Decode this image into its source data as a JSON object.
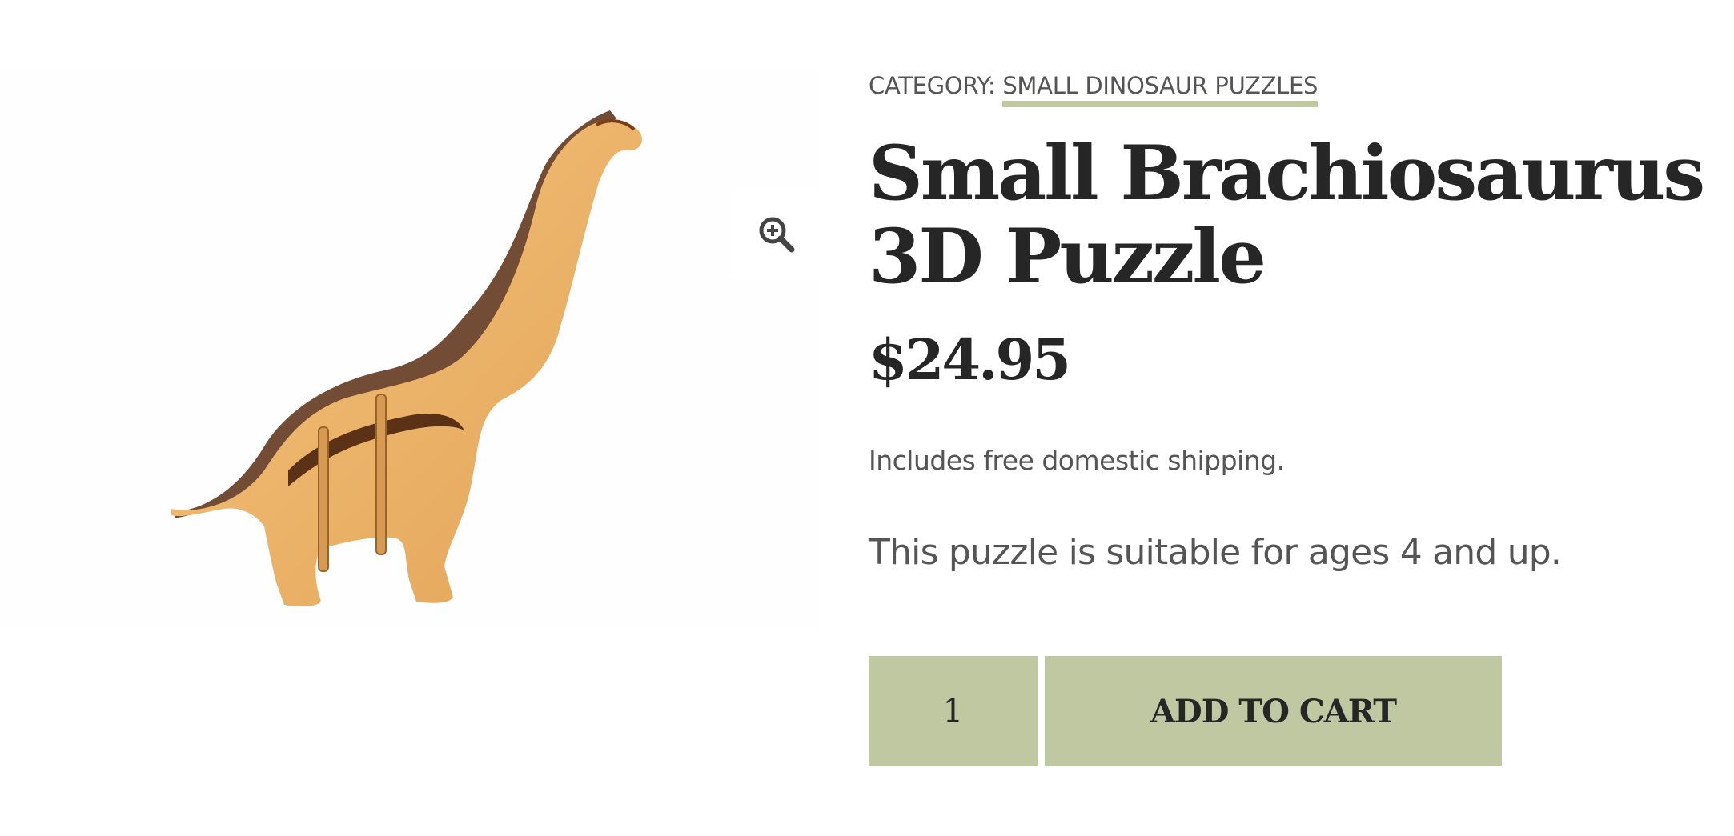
{
  "product": {
    "category_label": "CATEGORY:",
    "category_name": "SMALL DINOSAUR PUZZLES",
    "title": "Small Brachiosaurus 3D Puzzle",
    "price": "$24.95",
    "shipping_note": "Includes free domestic shipping.",
    "age_note": "This puzzle is suitable for ages 4 and up.",
    "image_icon": "brachiosaurus-puzzle-image"
  },
  "cart": {
    "quantity": "1",
    "add_to_cart_label": "ADD TO CART"
  },
  "icons": {
    "zoom": "zoom-in-icon"
  },
  "colors": {
    "accent": "#bfc8a1",
    "text_dark": "#262626",
    "text_muted": "#555555",
    "wood": "#eab064"
  }
}
